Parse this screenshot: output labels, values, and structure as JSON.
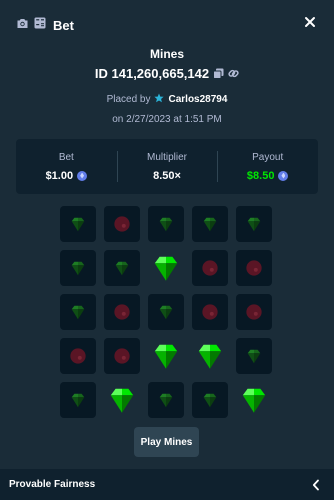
{
  "header": {
    "title": "Bet",
    "camera_icon": "camera-icon",
    "calculator_icon": "calculator-icon",
    "close_icon": "close-icon"
  },
  "bet": {
    "game": "Mines",
    "id_text": "ID 141,260,665,142",
    "placed_by_label": "Placed by",
    "user": "Carlos28794",
    "date": "on 2/27/2023 at 1:51 PM"
  },
  "stats": {
    "bet_label": "Bet",
    "bet_value": "$1.00",
    "multiplier_label": "Multiplier",
    "multiplier_value": "8.50×",
    "payout_label": "Payout",
    "payout_value": "$8.50"
  },
  "grid": {
    "rows": [
      [
        "gem",
        "mine",
        "gem",
        "gem",
        "gem"
      ],
      [
        "gem",
        "gem",
        "gem-revealed",
        "mine",
        "mine"
      ],
      [
        "gem",
        "mine",
        "gem",
        "mine",
        "mine"
      ],
      [
        "mine",
        "mine",
        "gem-revealed",
        "gem-revealed",
        "gem"
      ],
      [
        "gem",
        "gem-revealed",
        "gem",
        "gem",
        "gem-revealed"
      ]
    ]
  },
  "play_button": "Play Mines",
  "footer": {
    "label": "Provable Fairness"
  },
  "colors": {
    "background": "#1a2c38",
    "panel": "#0f212e",
    "payout": "#00e701",
    "gem": "#00e701",
    "mine": "#e9113c"
  }
}
